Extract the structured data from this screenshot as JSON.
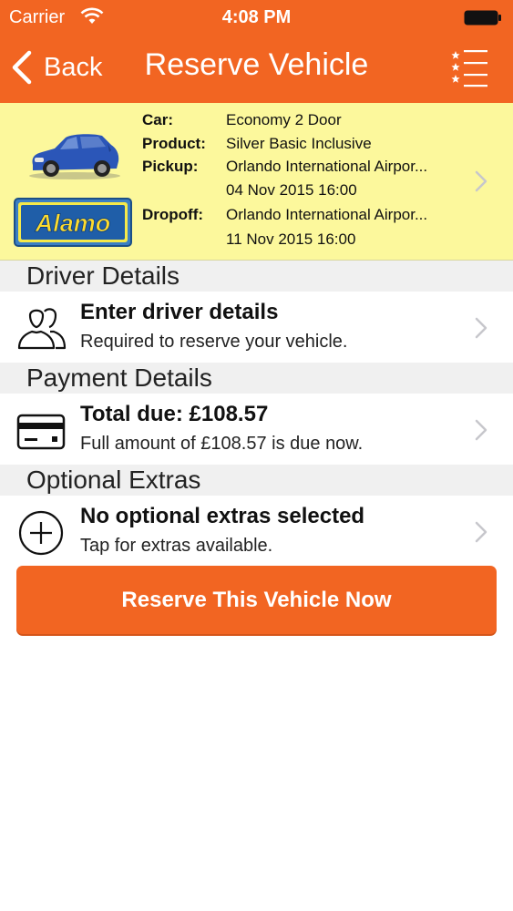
{
  "status_bar": {
    "carrier": "Carrier",
    "time": "4:08 PM"
  },
  "nav": {
    "back_label": "Back",
    "title": "Reserve Vehicle",
    "list_icon": "starred-list-icon"
  },
  "summary": {
    "car_label": "Car:",
    "car_value": "Economy 2 Door",
    "product_label": "Product:",
    "product_value": "Silver Basic Inclusive",
    "pickup_label": "Pickup:",
    "pickup_location": "Orlando International Airpor...",
    "pickup_datetime": "04 Nov 2015 16:00",
    "dropoff_label": "Dropoff:",
    "dropoff_location": "Orlando International Airpor...",
    "dropoff_datetime": "11 Nov 2015 16:00",
    "supplier_logo_text": "Alamo"
  },
  "sections": {
    "driver": {
      "header": "Driver Details",
      "title": "Enter driver details",
      "subtitle": "Required to reserve your vehicle.",
      "icon": "people-icon"
    },
    "payment": {
      "header": "Payment Details",
      "title": "Total due: £108.57",
      "subtitle": "Full amount of £108.57 is due now.",
      "icon": "credit-card-icon"
    },
    "extras": {
      "header": "Optional Extras",
      "title": "No optional extras selected",
      "subtitle": "Tap for extras available.",
      "icon": "add-circle-icon"
    }
  },
  "reserve_button": "Reserve This Vehicle Now",
  "colors": {
    "brand_orange": "#f26522",
    "summary_yellow": "#fcf89c",
    "section_grey": "#f0f0f0",
    "alamo_green": "#2f8f47",
    "alamo_text": "#fddb2e",
    "chevron": "#c7c7cc"
  }
}
